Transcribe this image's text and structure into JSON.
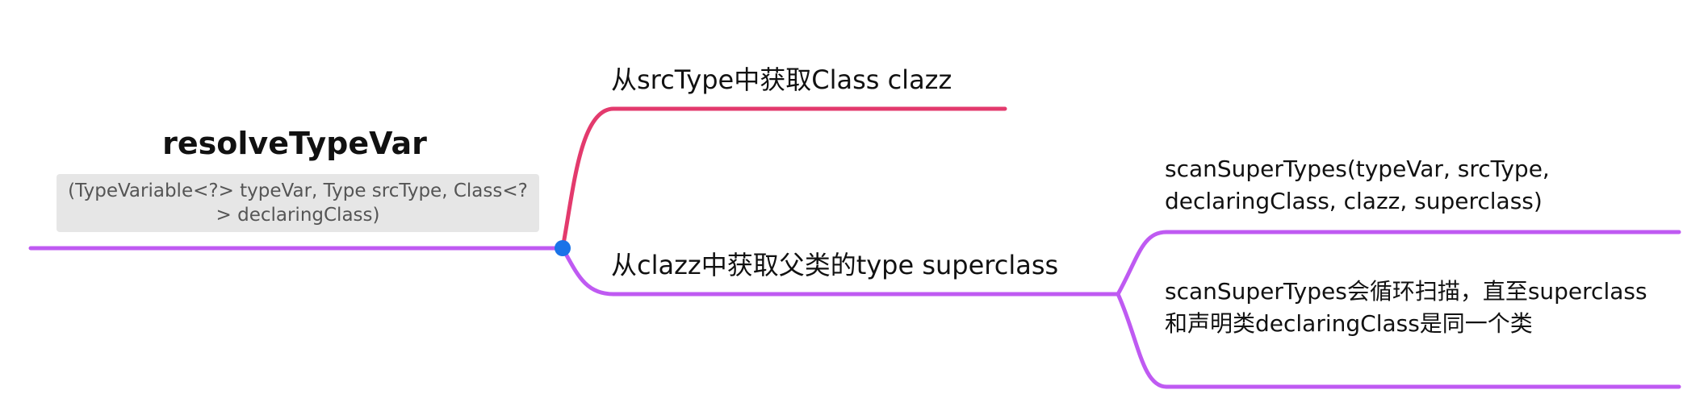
{
  "colors": {
    "main_branch": "#bf5af2",
    "second_branch": "#e33a6d",
    "connector_dot": "#1a73e8",
    "note_background": "#e6e6e6"
  },
  "root": {
    "title": "resolveTypeVar",
    "note": "(TypeVariable<?> typeVar, Type srcType, Class<?> declaringClass)"
  },
  "branches": [
    {
      "label": "从srcType中获取Class clazz",
      "children": []
    },
    {
      "label": "从clazz中获取父类的type superclass",
      "children": [
        {
          "label": "scanSuperTypes(typeVar, srcType, declaringClass, clazz, superclass)"
        },
        {
          "label": "scanSuperTypes会循环扫描，直至superclass和声明类declaringClass是同一个类"
        }
      ]
    }
  ]
}
